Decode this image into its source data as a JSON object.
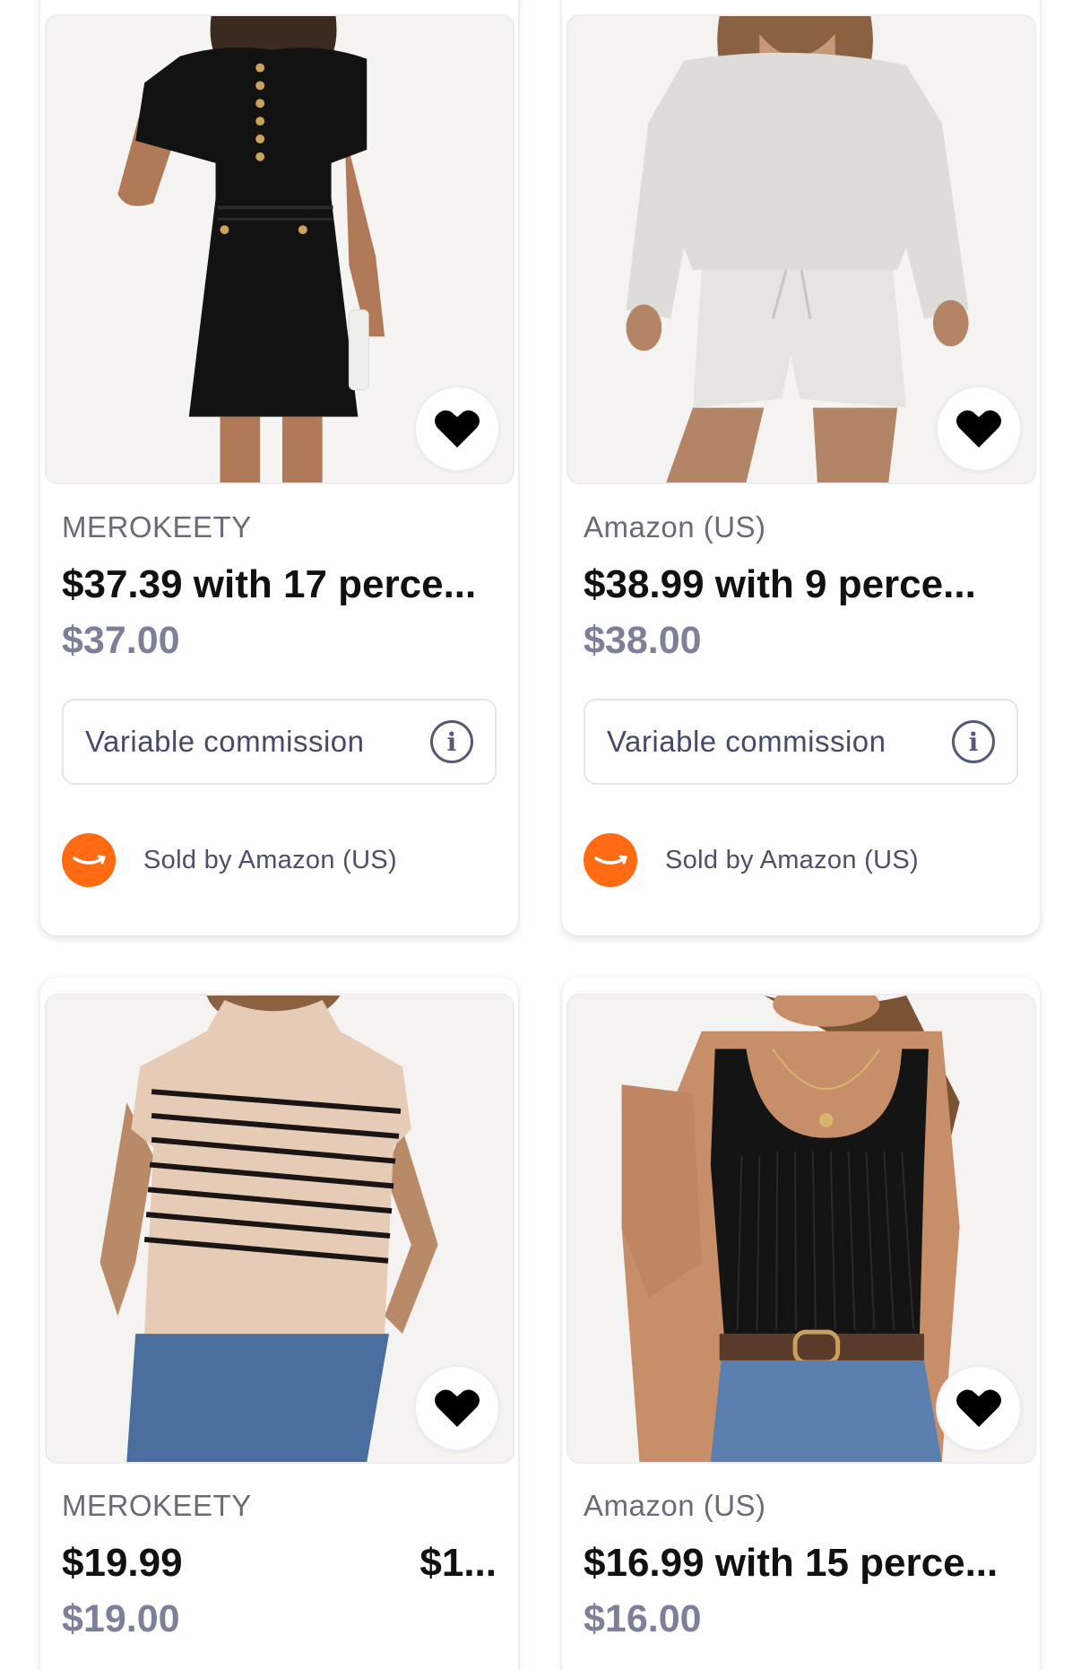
{
  "products": [
    {
      "retailer": "MEROKEETY",
      "price_main": "$37.39 with 17 perce...",
      "price_side": "",
      "price_sub": "$37.00",
      "commission_label": "Variable commission",
      "seller": "Sold by Amazon (US)",
      "image_icon": "black-mini-dress-image",
      "favorite_icon": "heart-icon"
    },
    {
      "retailer": "Amazon (US)",
      "price_main": "$38.99 with 9 perce...",
      "price_side": "",
      "price_sub": "$38.00",
      "commission_label": "Variable commission",
      "seller": "Sold by Amazon (US)",
      "image_icon": "gray-lounge-set-image",
      "favorite_icon": "heart-icon"
    },
    {
      "retailer": "MEROKEETY",
      "price_main": "$19.99",
      "price_side": "$1...",
      "price_sub": "$19.00",
      "image_icon": "striped-sweater-vest-image",
      "favorite_icon": "heart-icon"
    },
    {
      "retailer": "Amazon (US)",
      "price_main": "$16.99 with 15 perce...",
      "price_side": "",
      "price_sub": "$16.00",
      "image_icon": "black-ribbed-tank-image",
      "favorite_icon": "heart-icon"
    }
  ],
  "colors": {
    "seller_logo": "#ff6a13",
    "price_sub": "#7c8199",
    "text_primary": "#111111"
  }
}
